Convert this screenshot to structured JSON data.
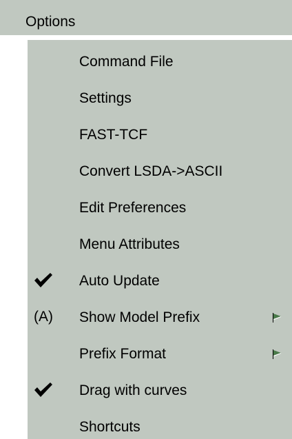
{
  "menubar": {
    "title": "Options"
  },
  "menu": {
    "items": [
      {
        "label": "Command File"
      },
      {
        "label": "Settings"
      },
      {
        "label": "FAST-TCF"
      },
      {
        "label": "Convert LSDA->ASCII"
      },
      {
        "label": "Edit Preferences"
      },
      {
        "label": "Menu Attributes"
      },
      {
        "label": "Auto Update",
        "checked": true
      },
      {
        "label": "Show Model Prefix",
        "prefix": "(A)",
        "submenu": true
      },
      {
        "label": "Prefix Format",
        "submenu": true
      },
      {
        "label": "Drag with curves",
        "checked": true
      },
      {
        "label": "Shortcuts"
      }
    ]
  },
  "icons": {
    "check": "checkmark-icon",
    "cascade": "cascade-arrow-icon"
  },
  "colors": {
    "menu_bg": "#c0c8c0",
    "text": "#000000",
    "arrow": "#4a7a4a"
  }
}
